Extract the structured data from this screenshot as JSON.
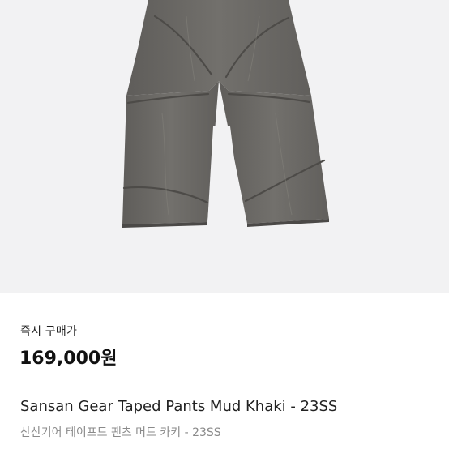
{
  "product": {
    "image_icon": "pants-product-photo",
    "price_caption": "즉시 구매가",
    "price": "169,000원",
    "title_en": "Sansan Gear Taped Pants Mud Khaki - 23SS",
    "title_ko": "산산기어 테이프드 팬츠 머드 카키 - 23SS"
  },
  "colors": {
    "image_bg": "#f2f2f3",
    "pants": "#6e6c69",
    "text_primary": "#222222",
    "text_secondary": "#8a8a8a"
  }
}
